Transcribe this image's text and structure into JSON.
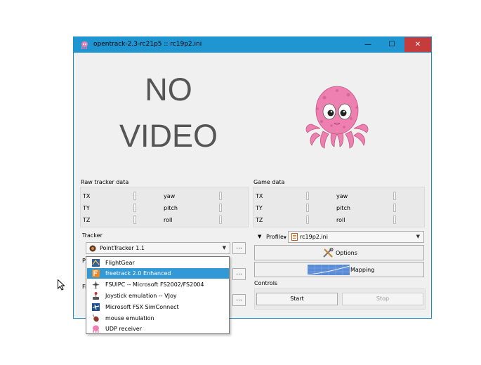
{
  "window": {
    "title": "opentrack-2.3-rc21p5 :: rc19p2.ini",
    "minimize_glyph": "—",
    "maximize_glyph": "☐",
    "close_glyph": "✕",
    "no_video_line1": "NO",
    "no_video_line2": "VIDEO"
  },
  "raw_tracker": {
    "label": "Raw tracker data",
    "axes": [
      "TX",
      "TY",
      "TZ",
      "yaw",
      "pitch",
      "roll"
    ]
  },
  "game_data": {
    "label": "Game data",
    "axes": [
      "TX",
      "TY",
      "TZ",
      "yaw",
      "pitch",
      "roll"
    ]
  },
  "tracker": {
    "label": "Tracker",
    "selected": "PointTracker 1.1",
    "dots": "..."
  },
  "protocol": {
    "label_partial": "P",
    "dots": "..."
  },
  "filter": {
    "label_partial": "Fi",
    "dots": "..."
  },
  "profile": {
    "label": "Profile",
    "selected": "rc19p2.ini"
  },
  "buttons": {
    "options": "Options",
    "mapping": "Mapping",
    "start": "Start",
    "stop": "Stop"
  },
  "controls": {
    "label": "Controls"
  },
  "protocol_dropdown": {
    "items": [
      {
        "label": "FlightGear",
        "icon": "flightgear-icon",
        "selected": false
      },
      {
        "label": "freetrack 2.0 Enhanced",
        "icon": "freetrack-icon",
        "selected": true
      },
      {
        "label": "FSUIPC -- Microsoft FS2002/FS2004",
        "icon": "fsuipc-icon",
        "selected": false
      },
      {
        "label": "Joystick emulation -- VJoy",
        "icon": "joystick-icon",
        "selected": false
      },
      {
        "label": "Microsoft FSX SimConnect",
        "icon": "fsx-icon",
        "selected": false
      },
      {
        "label": "mouse emulation",
        "icon": "mouse-icon",
        "selected": false
      },
      {
        "label": "UDP receiver",
        "icon": "udp-icon",
        "selected": false
      }
    ]
  },
  "colors": {
    "titlebar": "#1f95d1",
    "close": "#c53c3c",
    "selection": "#3399d6",
    "octopus": "#ee7fb1"
  }
}
